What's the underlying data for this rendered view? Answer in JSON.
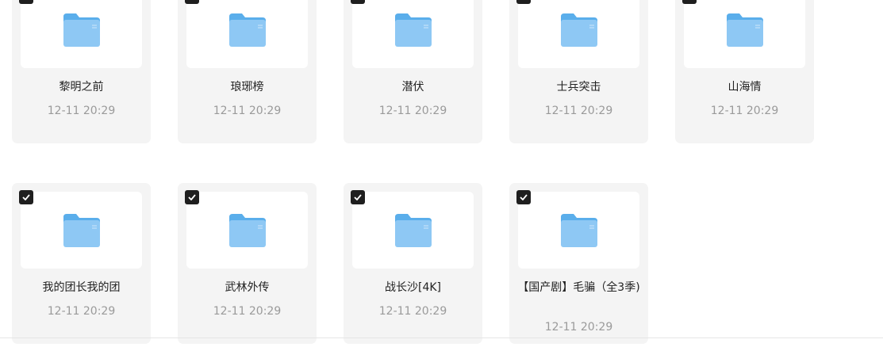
{
  "files": [
    {
      "name": "黎明之前",
      "date": "12-11 20:29",
      "checked": true
    },
    {
      "name": "琅琊榜",
      "date": "12-11 20:29",
      "checked": true
    },
    {
      "name": "潜伏",
      "date": "12-11 20:29",
      "checked": true
    },
    {
      "name": "士兵突击",
      "date": "12-11 20:29",
      "checked": true
    },
    {
      "name": "山海情",
      "date": "12-11 20:29",
      "checked": true
    },
    {
      "name": "我的团长我的团",
      "date": "12-11 20:29",
      "checked": true
    },
    {
      "name": "武林外传",
      "date": "12-11 20:29",
      "checked": true
    },
    {
      "name": "战长沙[4K]",
      "date": "12-11 20:29",
      "checked": true
    },
    {
      "name": "【国产剧】毛骗（全3季)",
      "date": "12-11 20:29",
      "checked": true
    }
  ],
  "colors": {
    "card_bg": "#f4f4f4",
    "folder_front": "#8ec8f4",
    "folder_back": "#5aaeeb",
    "checkbox_bg": "#1f1f1f",
    "date_text": "#9a9a9a"
  },
  "icons": {
    "folder": "folder-icon",
    "checkbox": "checkbox-checked-icon"
  }
}
